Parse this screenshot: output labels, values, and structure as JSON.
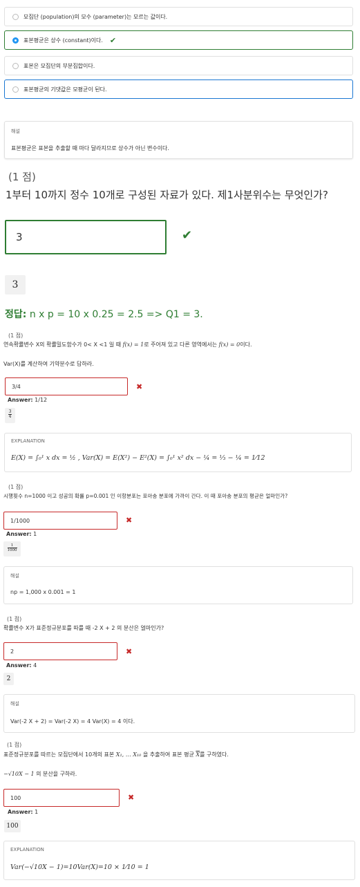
{
  "q_prev": {
    "options": [
      {
        "label": "모집단 (population)의 모수 (parameter)는 모르는 값이다."
      },
      {
        "label": "표본평균은 상수 (constant)이다."
      },
      {
        "label": "표본은 모집단의 부분집합이다."
      },
      {
        "label": "표본평균의 기댓값은 모평균이 된다."
      }
    ],
    "explanation_caption": "해설",
    "explanation_text": "표본평균은 표본을 추출할 때 마다 달라지므로 상수가 아닌 변수이다."
  },
  "q1": {
    "points": "(1 점)",
    "question": "1부터 10까지 정수 10개로 구성된 자료가 있다. 제1사분위수는 무엇인가?",
    "input_value": "3",
    "rendered": "3",
    "correct_label": "정답:",
    "correct_text": "n x p = 10 x 0.25 = 2.5 => Q1 = 3."
  },
  "q2": {
    "points": "(1 점)",
    "question_a": "연속확률변수 X의 확률밀도함수가 0< X <1 일 때",
    "question_b": "로 주어져 있고 다른 영역에서는",
    "question_c": "이다.",
    "math_fx1": "f(x) = 1",
    "math_fx0": "f(x) = 0",
    "question2": "Var(X)를 계산하여 기약분수로 답하라.",
    "input_value": "3/4",
    "answer_label": "Answer:",
    "answer_value": "1/12",
    "rendered_num": "3",
    "rendered_den": "4",
    "explanation_caption": "EXPLANATION",
    "explanation_math": "E(X) = ∫₀¹ x dx = ½ , Var(X) = E(X²) − E²(X) = ∫₀¹ x² dx − ¼ = ⅓ − ¼ = 1⁄12"
  },
  "q3": {
    "points": "(1 점)",
    "question": "시행횟수 n=1000 이고 성공의 확률 p=0.001 인 이항분포는 포아송 분포에 가까이 간다. 이 때 포아송 분포의 평균은 얼마인가?",
    "input_value": "1/1000",
    "answer_label": "Answer:",
    "answer_value": "1",
    "rendered_num": "1",
    "rendered_den": "1000",
    "explanation_caption": "해설",
    "explanation_text": "np = 1,000 x 0.001 = 1"
  },
  "q4": {
    "points": "(1 점)",
    "question": "확률변수 X가 표준정규분포를 따를 때 -2 X + 2 의 분산은 얼마인가?",
    "input_value": "2",
    "answer_label": "Answer:",
    "answer_value": "4",
    "rendered": "2",
    "explanation_caption": "해설",
    "explanation_text": "Var(-2 X + 2) = Var(-2 X) = 4 Var(X) = 4 이다."
  },
  "q5": {
    "points": "(1 점)",
    "question_a": "표준정규분포를 따르는 모집단에서 10개의 표본",
    "question_math": "X₁, … X₁₀",
    "question_b": "을 추출하여 표본 평균",
    "question_xbar": "X",
    "question_c": "를 구하였다.",
    "question2_math": "−√10X − 1",
    "question2_text": "의 분산을 구하라.",
    "input_value": "100",
    "answer_label": "Answer:",
    "answer_value": "1",
    "rendered": "100",
    "explanation_caption": "EXPLANATION",
    "explanation_math": "Var(−√10X − 1)=10Var(X)=10 × 1⁄10 = 1"
  },
  "colors": {
    "correct_green": "#2e7d32",
    "wrong_red": "#c62828",
    "radio_blue": "#2196f3",
    "focus_blue": "#1976d2"
  }
}
